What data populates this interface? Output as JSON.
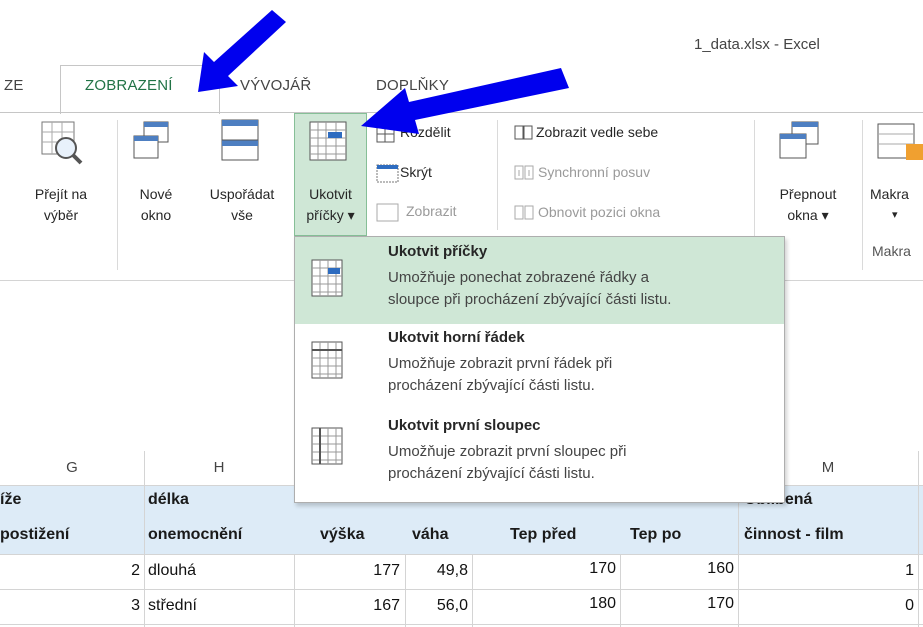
{
  "window": {
    "title": "1_data.xlsx - Excel"
  },
  "tabs": [
    {
      "label": "ZE"
    },
    {
      "label": "ZOBRAZENÍ"
    },
    {
      "label": "VÝVOJÁŘ"
    },
    {
      "label": "DOPLŇKY"
    }
  ],
  "ribbon": {
    "goto_selection": [
      "Přejít na",
      "výběr"
    ],
    "new_window": [
      "Nové",
      "okno"
    ],
    "arrange_all": [
      "Uspořádat",
      "vše"
    ],
    "freeze_panes": [
      "Ukotvit",
      "příčky ▾"
    ],
    "split": "Rozdělit",
    "hide": "Skrýt",
    "unhide": "Zobrazit",
    "view_side_by_side": "Zobrazit vedle sebe",
    "synchronous_scrolling": "Synchronní posuv",
    "reset_window_position": "Obnovit pozici okna",
    "switch_windows": [
      "Přepnout",
      "okna ▾"
    ],
    "macros": [
      "Makra",
      "▾"
    ],
    "macros_group": "Makra"
  },
  "freeze_menu": [
    {
      "title": "Ukotvit příčky",
      "desc": [
        "Umožňuje ponechat zobrazené řádky a",
        "sloupce při procházení zbývající části listu."
      ]
    },
    {
      "title": "Ukotvit horní řádek",
      "desc": [
        "Umožňuje zobrazit první řádek při",
        "procházení zbývající části listu."
      ]
    },
    {
      "title": "Ukotvit první sloupec",
      "desc": [
        "Umožňuje zobrazit první sloupec při",
        "procházení zbývající části listu."
      ]
    }
  ],
  "sheet": {
    "columns": [
      "G",
      "H",
      "M"
    ],
    "headers": {
      "g": [
        "íže",
        "postižení"
      ],
      "h": [
        "délka",
        "onemocnění"
      ],
      "height": "výška",
      "weight": "váha",
      "hr_before": "Tep před",
      "hr_after": "Tep po",
      "fav": [
        "Oblíbená",
        "činnost - film"
      ]
    },
    "rows": [
      {
        "g": "2",
        "h": "dlouhá",
        "height": "177",
        "weight": "49,8",
        "hr_before": "170",
        "hr_after": "160",
        "fav": "1"
      },
      {
        "g": "3",
        "h": "střední",
        "height": "167",
        "weight": "56,0",
        "hr_before": "180",
        "hr_after": "170",
        "fav": "0"
      }
    ]
  },
  "colors": {
    "accent": "#217346",
    "highlight": "#cfe7d6",
    "header_fill": "#ddebf7",
    "arrow": "#0000ee"
  }
}
